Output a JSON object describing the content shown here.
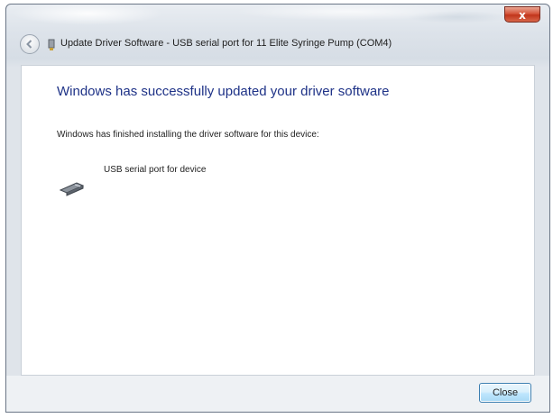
{
  "window": {
    "title": "Update Driver Software - USB serial port for 11 Elite Syringe Pump (COM4)",
    "close_glyph": "x"
  },
  "main": {
    "heading": "Windows has successfully updated your driver software",
    "description": "Windows has finished installing the driver software for this device:",
    "device": {
      "label": "USB serial port for device",
      "icon": "usb-device-icon"
    }
  },
  "footer": {
    "close_label": "Close"
  },
  "colors": {
    "heading": "#1e3287",
    "close_button_border": "#3c7fb1",
    "window_close_red": "#c1351c"
  }
}
